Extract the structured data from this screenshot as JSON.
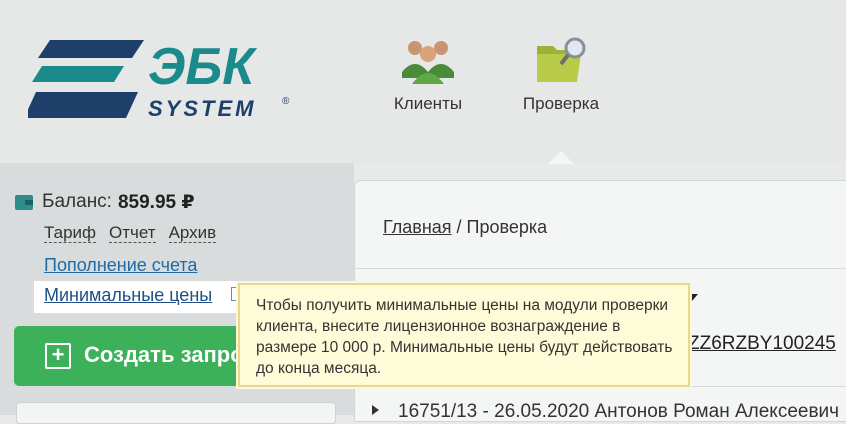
{
  "logo": {
    "primary": "ЭБК",
    "secondary": "SYSTEM",
    "mark": "®"
  },
  "nav": {
    "clients": {
      "label": "Клиенты",
      "icon": "users-icon"
    },
    "check": {
      "label": "Проверка",
      "icon": "folder-search-icon"
    }
  },
  "sidebar": {
    "balance_label": "Баланс:",
    "balance_value": "859.95 ₽",
    "links": {
      "tariff": "Тариф",
      "report": "Отчет",
      "archive": "Архив"
    },
    "topup": "Пополнение счета",
    "min_prices": "Минимальные цены",
    "help": "?",
    "create_plus": "+",
    "create_label": "Создать запрос"
  },
  "main": {
    "breadcrumb_home": "Главная",
    "breadcrumb_sep": " / ",
    "breadcrumb_current": "Проверка",
    "code_fragment": "ZZ6RZBY100245",
    "row_text": "16751/13 - 26.05.2020    Антонов Роман Алексеевич"
  },
  "tooltip": {
    "text": "Чтобы получить минимальные цены на модули проверки клиента, внесите лицензионное вознаграждение в размере 10 000 р. Минимальные цены будут действовать до конца месяца."
  },
  "colors": {
    "accent_green": "#3db15a",
    "logo_blue": "#1f3f6b",
    "logo_teal": "#1a8a8a",
    "link_blue": "#1d6aa8"
  }
}
